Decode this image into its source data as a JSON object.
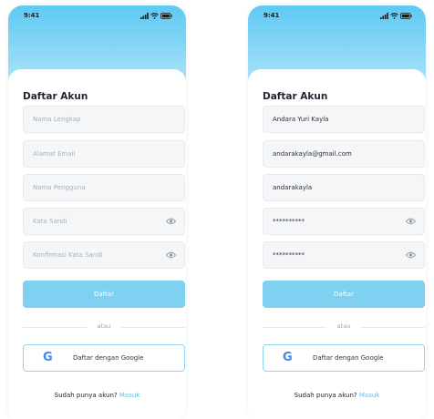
{
  "status_bar": {
    "time": "9:41",
    "icons": [
      "signal-icon",
      "wifi-icon",
      "battery-icon"
    ]
  },
  "colors": {
    "accent": "#5ec9f3",
    "button": "#7fd0f1",
    "link": "#57c1ee"
  },
  "screens": [
    {
      "title": "Daftar Akun",
      "fields": {
        "full_name": "Nama Lengkap",
        "email": "Alamat Email",
        "username": "Nama Pengguna",
        "password": "Kata Sandi",
        "confirm_password": "Konfirmasi Kata Sandi"
      },
      "register_label": "Daftar",
      "or_label": "atau",
      "google_label": "Daftar dengan Google",
      "footer_text": "Sudah punya akun?",
      "footer_link": "Masuk"
    },
    {
      "title": "Daftar Akun",
      "fields": {
        "full_name": "Andara Yuri Kayla",
        "email": "andarakayla@gmail.com",
        "username": "andarakayla",
        "password": "**********",
        "confirm_password": "**********"
      },
      "register_label": "Daftar",
      "or_label": "atau",
      "google_label": "Daftar dengan Google",
      "footer_text": "Sudah punya akun?",
      "footer_link": "Masuk"
    }
  ]
}
